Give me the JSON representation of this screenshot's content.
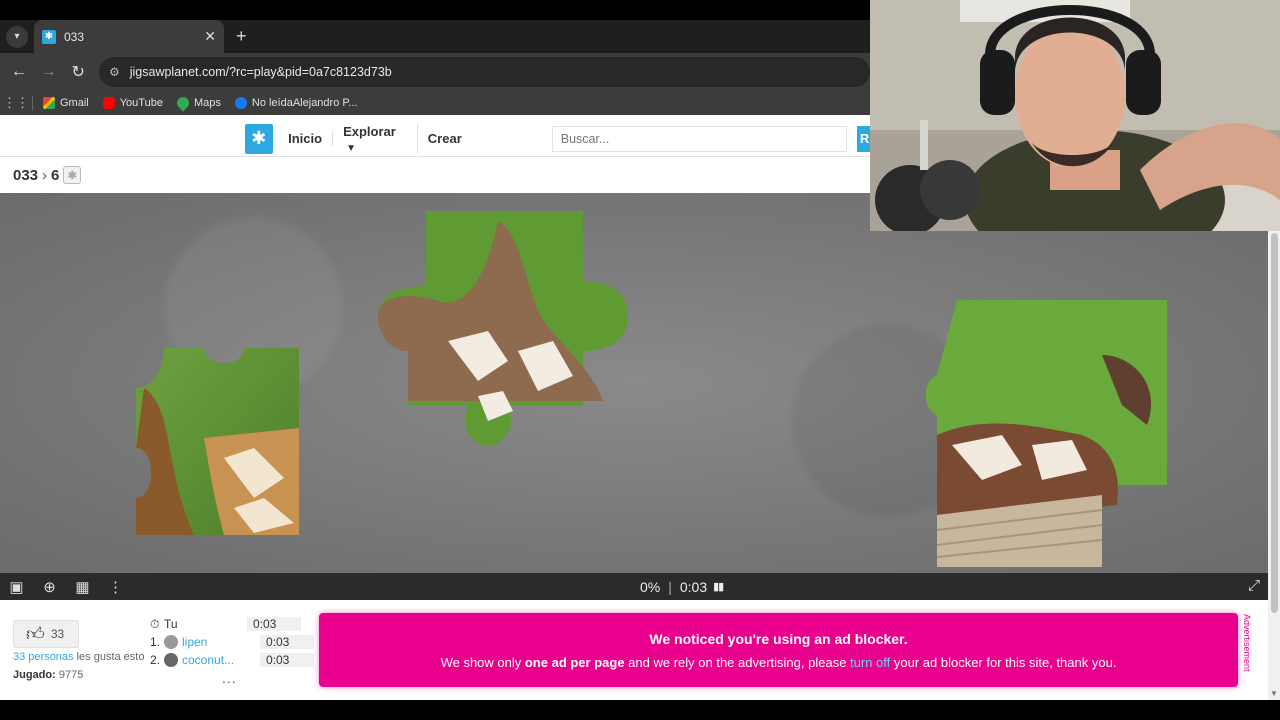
{
  "browser": {
    "tab_title": "033",
    "url": "jigsawplanet.com/?rc=play&pid=0a7c8123d73b",
    "bookmarks": [
      "Gmail",
      "YouTube",
      "Maps",
      "No leídaAlejandro P..."
    ]
  },
  "site": {
    "nav": [
      "Inicio",
      "Explorar",
      "Crear"
    ],
    "search_placeholder": "Buscar...",
    "search_button": "R"
  },
  "breadcrumb": {
    "root": "033",
    "pieces": "6"
  },
  "status": {
    "progress": "0%",
    "progress_value": 0,
    "timer": "0:03"
  },
  "likes": {
    "count": "33",
    "text_link": "33 personas",
    "text_rest": " les gusta esto",
    "played_label": "Jugado:",
    "played_value": "9775"
  },
  "scores": {
    "you_label": "Tu",
    "you_time": "0:03",
    "rows": [
      {
        "rank": "1.",
        "name": "lipen",
        "time": "0:03"
      },
      {
        "rank": "2.",
        "name": "coconut...",
        "time": "0:03"
      }
    ],
    "more": "..."
  },
  "ad": {
    "title": "We noticed you're using an ad blocker.",
    "msg_1": "We show only ",
    "msg_bold": "one ad per page",
    "msg_2": " and we rely on the advertising, please ",
    "msg_link": "turn off",
    "msg_3": " your ad blocker for this site, thank you.",
    "side_label": "Advertisement"
  },
  "colors": {
    "accent": "#2ea8e0",
    "ad_pink": "#e9008c"
  }
}
